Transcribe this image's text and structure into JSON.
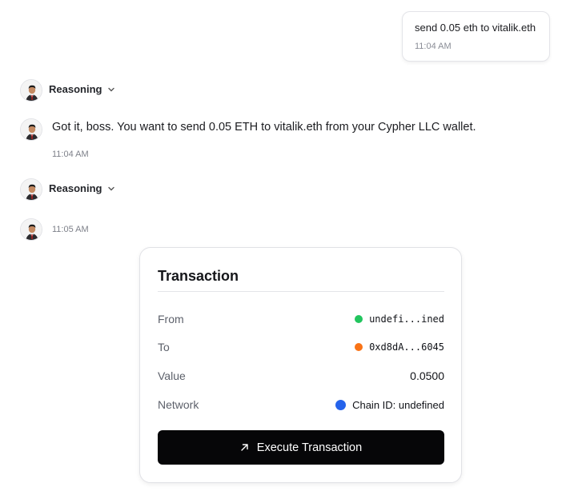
{
  "user_message": {
    "text": "send 0.05 eth to vitalik.eth",
    "time": "11:04 AM"
  },
  "reasoning_1": {
    "label": "Reasoning",
    "icon": "chevron-down-icon"
  },
  "assistant_message": {
    "text": "Got it, boss. You want to send 0.05 ETH to vitalik.eth from your Cypher LLC wallet.",
    "time": "11:04 AM"
  },
  "reasoning_2": {
    "label": "Reasoning",
    "icon": "chevron-down-icon"
  },
  "assistant_message_2": {
    "time": "11:05 AM"
  },
  "transaction": {
    "title": "Transaction",
    "rows": [
      {
        "label": "From",
        "value": "undefi...ined",
        "dot_color": "#22c55e"
      },
      {
        "label": "To",
        "value": "0xd8dA...6045",
        "dot_color": "#f97316"
      },
      {
        "label": "Value",
        "value": "0.0500"
      },
      {
        "label": "Network",
        "value": "Chain ID: undefined",
        "dot_color": "#2563eb"
      }
    ],
    "button_label": "Execute Transaction",
    "button_icon": "arrow-up-right-icon"
  }
}
